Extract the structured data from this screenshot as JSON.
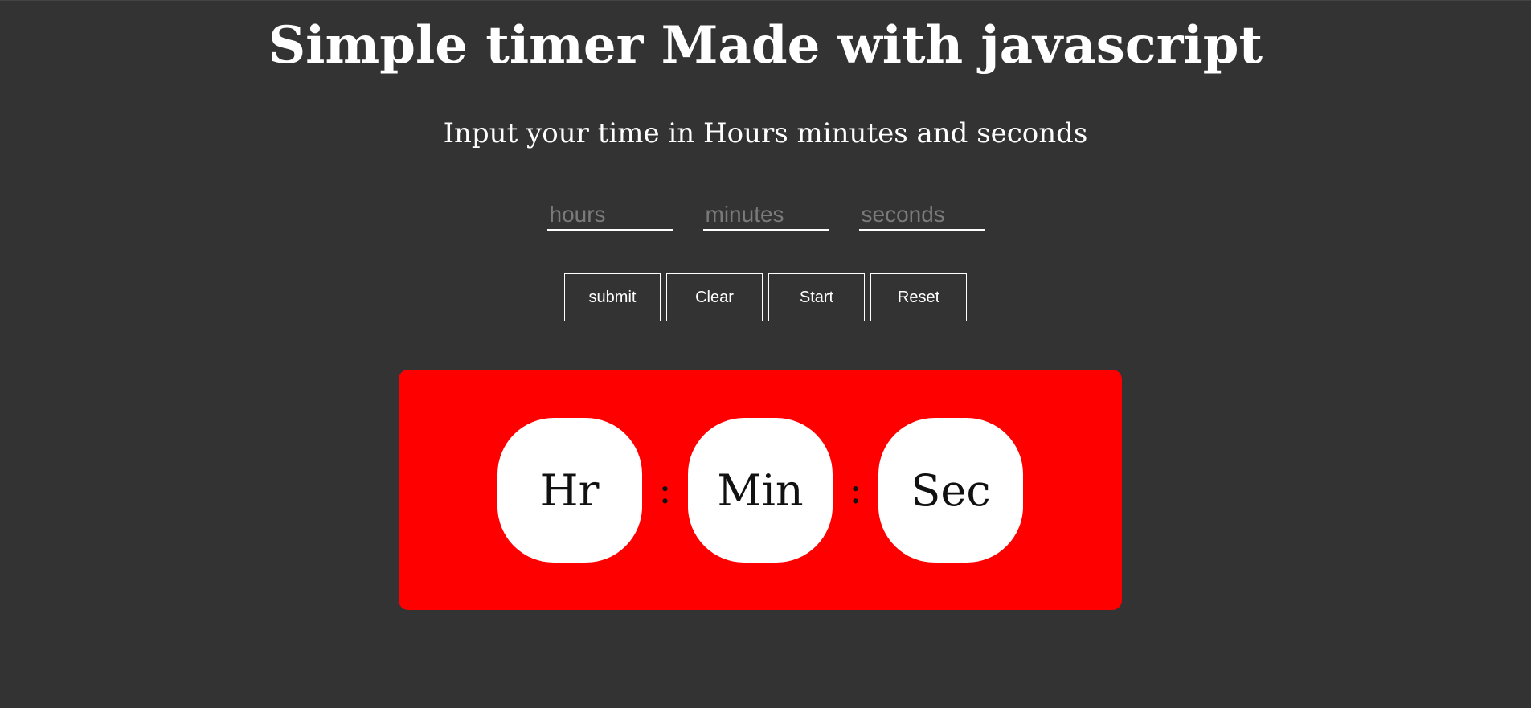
{
  "header": {
    "title": "Simple timer Made with javascript",
    "subtitle": "Input your time in Hours minutes and seconds"
  },
  "inputs": {
    "hours_placeholder": "hours",
    "minutes_placeholder": "minutes",
    "seconds_placeholder": "seconds"
  },
  "buttons": {
    "submit": "submit",
    "clear": "Clear",
    "start": "Start",
    "reset": "Reset"
  },
  "timer": {
    "hours_label": "Hr",
    "minutes_label": "Min",
    "seconds_label": "Sec",
    "separator": ":"
  },
  "colors": {
    "background": "#333333",
    "panel": "#ff0000",
    "box": "#ffffff",
    "text": "#ffffff"
  }
}
